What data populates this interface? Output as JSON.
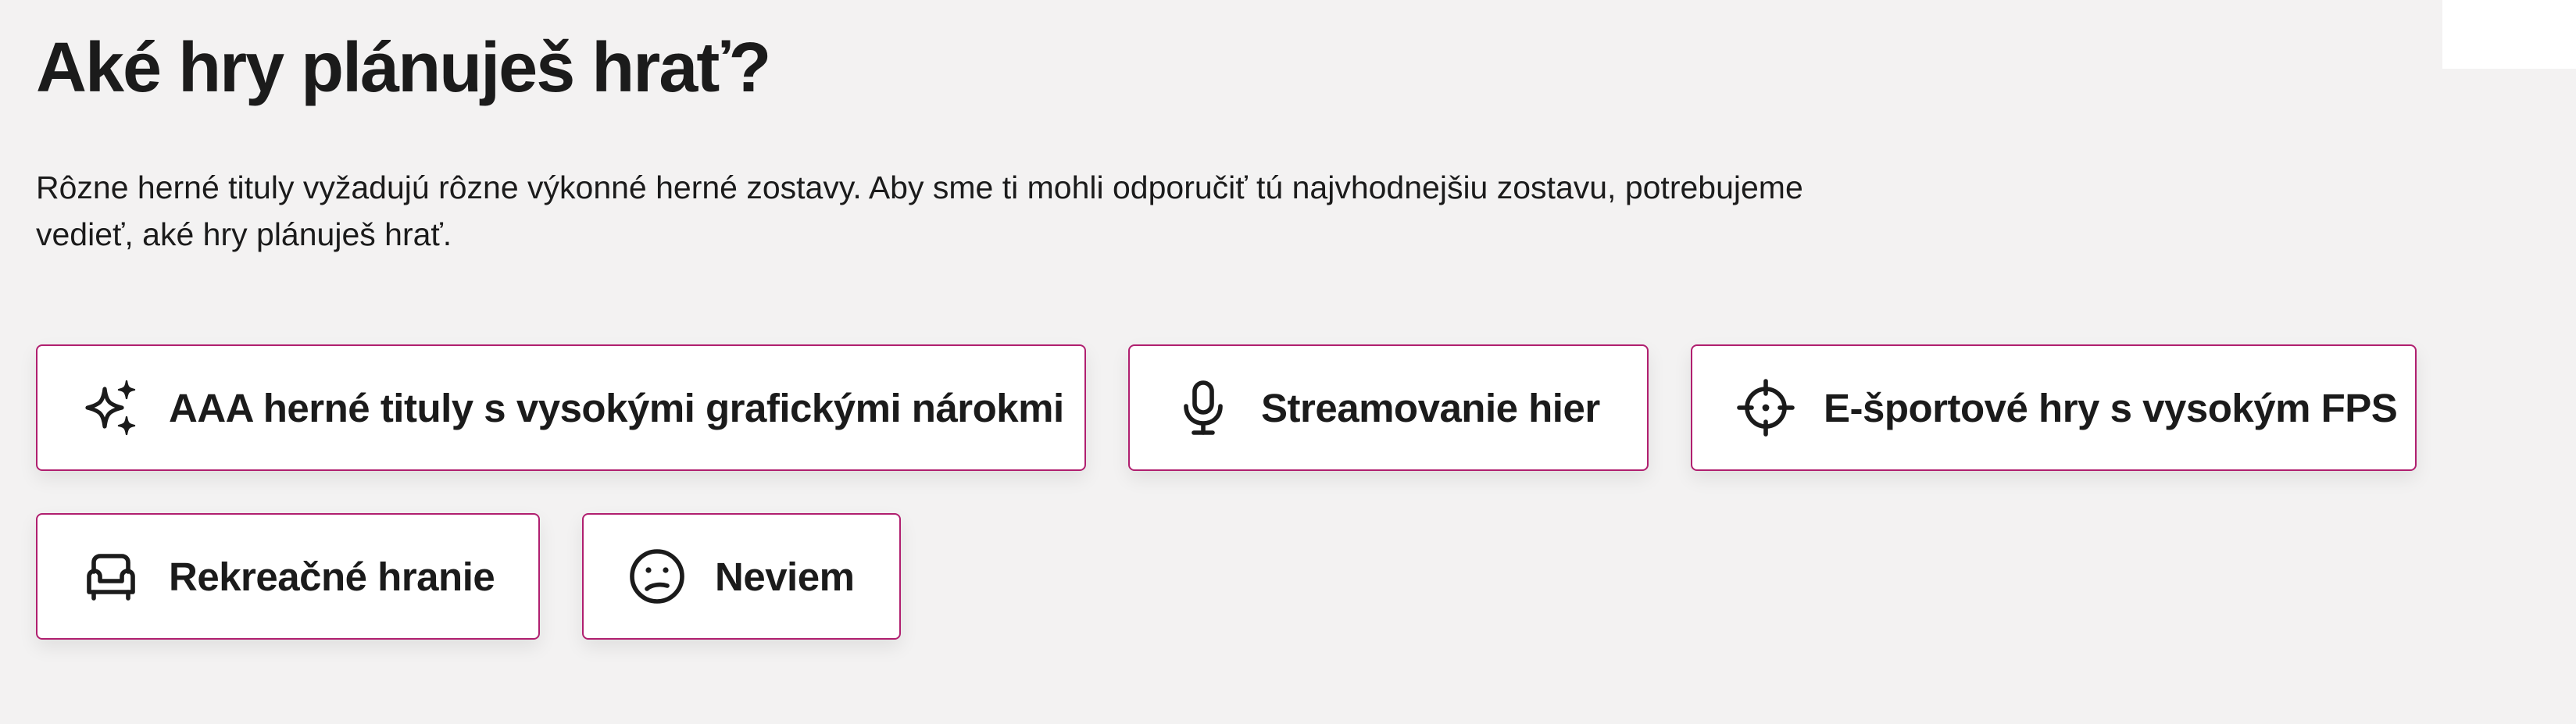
{
  "title": "Aké hry plánuješ hrať?",
  "description": "Rôzne herné tituly vyžadujú rôzne výkonné herné zostavy. Aby sme ti mohli odporučiť tú najvhodnejšiu zostavu, potrebujeme vedieť, aké hry plánuješ hrať.",
  "options": [
    {
      "label": "AAA herné tituly s vysokými grafickými nárokmi",
      "icon": "sparkles-icon"
    },
    {
      "label": "Streamovanie hier",
      "icon": "microphone-icon"
    },
    {
      "label": "E-športové hry s vysokým FPS",
      "icon": "crosshair-icon"
    },
    {
      "label": "Rekreačné hranie",
      "icon": "armchair-icon"
    },
    {
      "label": "Neviem",
      "icon": "confused-face-icon"
    }
  ],
  "colors": {
    "background": "#f3f2f2",
    "card_background": "#ffffff",
    "card_border": "#b01f6f",
    "text": "#1b1b1b"
  }
}
